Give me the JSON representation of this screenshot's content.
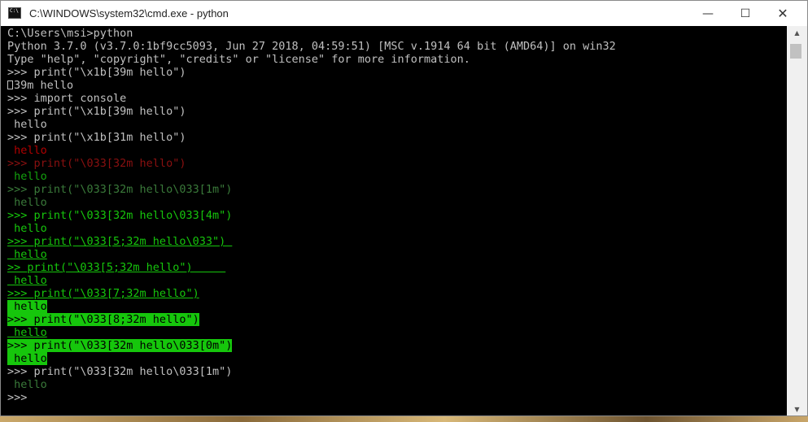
{
  "window": {
    "title": "C:\\WINDOWS\\system32\\cmd.exe - python",
    "minimize_glyph": "—",
    "maximize_glyph": "☐",
    "close_glyph": "✕"
  },
  "console": {
    "lines": [
      {
        "text": "C:\\Users\\msi>python",
        "style": "gray"
      },
      {
        "text": "Python 3.7.0 (v3.7.0:1bf9cc5093, Jun 27 2018, 04:59:51) [MSC v.1914 64 bit (AMD64)] on win32",
        "style": "gray"
      },
      {
        "text": "Type \"help\", \"copyright\", \"credits\" or \"license\" for more information.",
        "style": "gray"
      },
      {
        "text": ">>> print(\"\\x1b[39m hello\")",
        "style": "gray"
      },
      {
        "text": "39m hello",
        "style": "gray",
        "box": true
      },
      {
        "text": ">>> import console",
        "style": "gray"
      },
      {
        "text": ">>> print(\"\\x1b[39m hello\")",
        "style": "gray"
      },
      {
        "text": " hello",
        "style": "gray"
      },
      {
        "text": ">>> print(\"\\x1b[31m hello\")",
        "style": "gray"
      },
      {
        "text": " hello",
        "style": "red"
      },
      {
        "text": ">>> print(\"\\033[32m hello\")",
        "style": "dred"
      },
      {
        "text": " hello",
        "style": "green"
      },
      {
        "text": ">>> print(\"\\033[32m hello\\033[1m\")",
        "style": "dgreen"
      },
      {
        "text": " hello",
        "style": "dgreen"
      },
      {
        "text": ">>> print(\"\\033[32m hello\\033[4m\")",
        "style": "bgreen"
      },
      {
        "text": " hello",
        "style": "bgreen"
      },
      {
        "text": ">>> print(\"\\033[5;32m hello\\033\") ",
        "style": "bgreen-u"
      },
      {
        "text": " hello",
        "style": "bgreen-u"
      },
      {
        "text": ">> print(\"\\033[5;32m hello\")     ",
        "style": "bgreen-u"
      },
      {
        "text": " hello",
        "style": "bgreen-u"
      },
      {
        "text": ">>> print(\"\\033[7;32m hello\")",
        "style": "bgreen-u"
      },
      {
        "text": " hello",
        "style": "inv"
      },
      {
        "text": ">>> print(\"\\033[8;32m hello\")",
        "style": "inv"
      },
      {
        "text": " hello",
        "style": "bgreen-u"
      },
      {
        "text": ">>> print(\"\\033[32m hello\\033[0m\")",
        "style": "inv"
      },
      {
        "text": " hello",
        "style": "inv"
      },
      {
        "text": ">>> print(\"\\033[32m hello\\033[1m\")",
        "style": "gray"
      },
      {
        "text": " hello",
        "style": "dgreen"
      },
      {
        "text": ">>>",
        "style": "gray"
      }
    ]
  },
  "scrollbar": {
    "up_glyph": "▲",
    "down_glyph": "▼"
  }
}
